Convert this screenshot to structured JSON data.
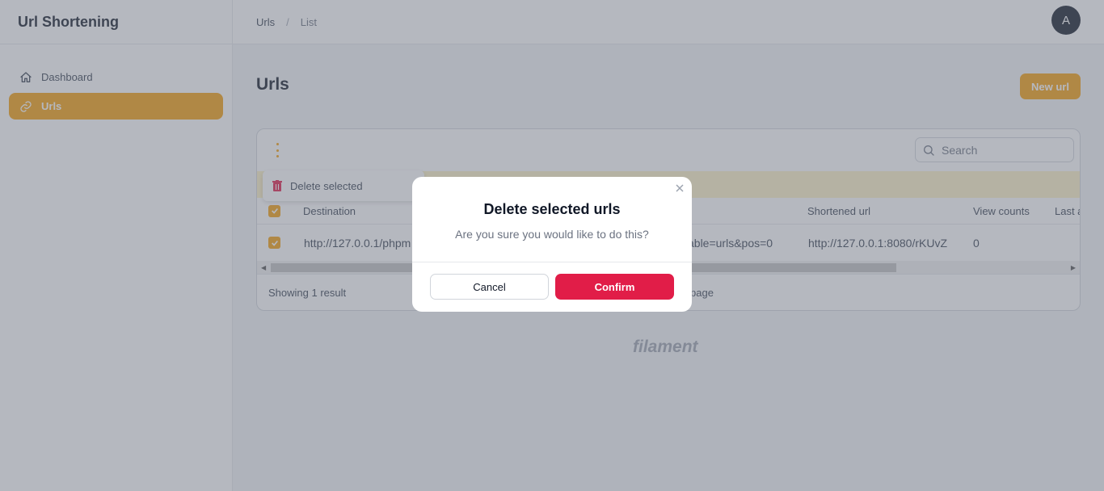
{
  "app": {
    "title": "Url Shortening",
    "avatar_initial": "A"
  },
  "sidebar": {
    "items": [
      {
        "label": "Dashboard",
        "icon": "home-icon",
        "active": false
      },
      {
        "label": "Urls",
        "icon": "link-icon",
        "active": true
      }
    ]
  },
  "breadcrumb": {
    "items": [
      "Urls",
      "List"
    ]
  },
  "page": {
    "title": "Urls",
    "new_button_label": "New url"
  },
  "table": {
    "search_placeholder": "Search",
    "bulk_actions": [
      {
        "label": "Delete selected",
        "icon": "trash-icon"
      }
    ],
    "columns": [
      "Destination",
      "Shortened url",
      "View counts",
      "Last a"
    ],
    "rows": [
      {
        "checked": true,
        "destination_visible_start": "http://127.0.0.1/phpm",
        "destination_visible_end": "able=urls&pos=0",
        "shortened_url": "http://127.0.0.1:8080/rKUvZ",
        "view_counts": "0"
      }
    ],
    "footer": {
      "result_text": "Showing 1 result",
      "per_page_fragment": "page"
    }
  },
  "footer_brand": "filament",
  "modal": {
    "title": "Delete selected urls",
    "description": "Are you sure you would like to do this?",
    "cancel_label": "Cancel",
    "confirm_label": "Confirm"
  },
  "colors": {
    "primary": "#f59e0b",
    "danger": "#e11d48",
    "overlay": "rgba(107,114,128,0.5)"
  }
}
